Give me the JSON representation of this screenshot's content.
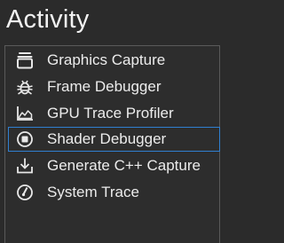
{
  "panel": {
    "title": "Activity"
  },
  "items": [
    {
      "label": "Graphics Capture",
      "icon": "graphics-capture-icon"
    },
    {
      "label": "Frame Debugger",
      "icon": "bug-icon"
    },
    {
      "label": "GPU Trace Profiler",
      "icon": "area-chart-icon"
    },
    {
      "label": "Shader Debugger",
      "icon": "stop-circle-icon",
      "selected": true
    },
    {
      "label": "Generate C++ Capture",
      "icon": "download-icon"
    },
    {
      "label": "System Trace",
      "icon": "gauge-icon"
    }
  ],
  "colors": {
    "background": "#2b2b2b",
    "selection_border": "#2f7fd0",
    "text": "#ececec"
  }
}
